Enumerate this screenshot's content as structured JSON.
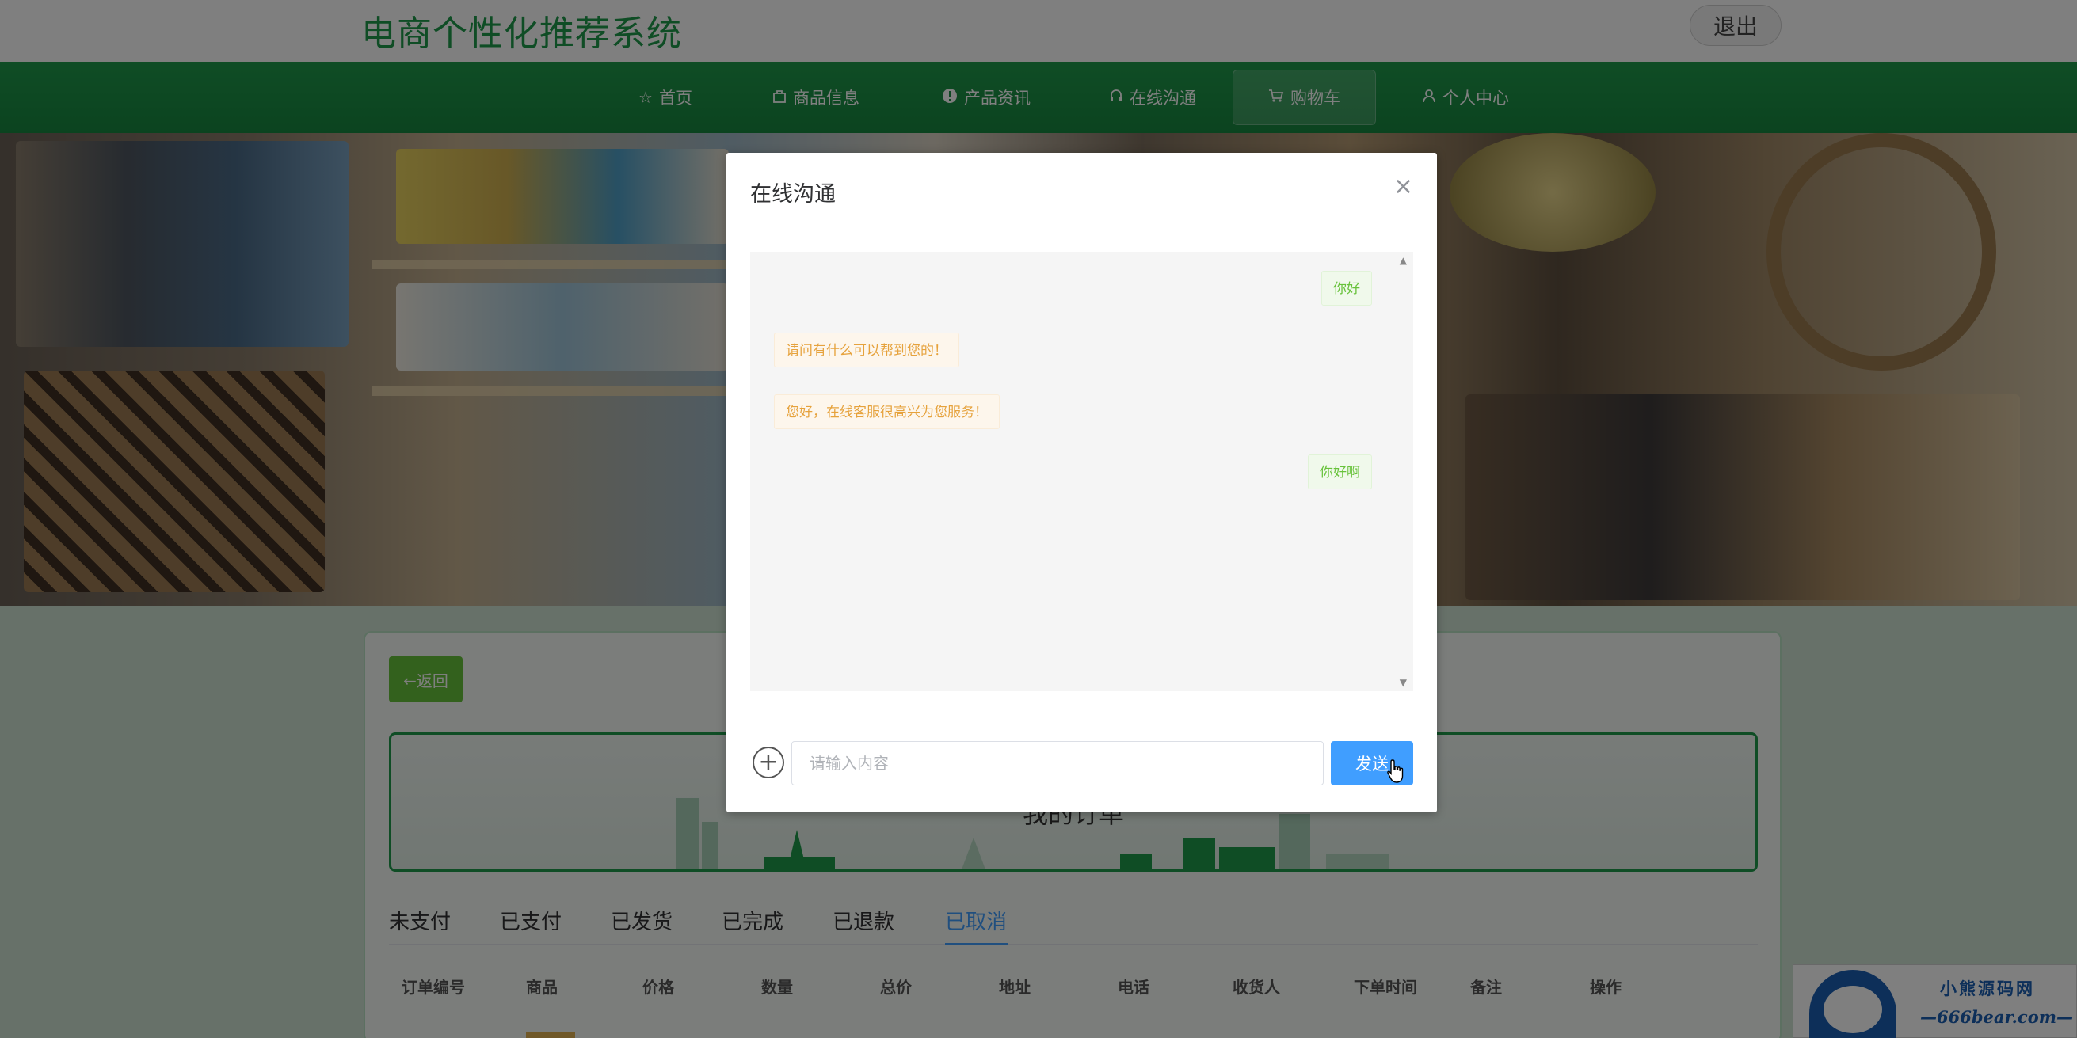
{
  "header": {
    "site_title": "电商个性化推荐系统",
    "logout_label": "退出"
  },
  "nav": {
    "items": [
      {
        "label": "首页",
        "icon": "star-icon"
      },
      {
        "label": "商品信息",
        "icon": "bag-icon"
      },
      {
        "label": "产品资讯",
        "icon": "info-icon"
      },
      {
        "label": "在线沟通",
        "icon": "headset-icon"
      },
      {
        "label": "购物车",
        "icon": "cart-icon",
        "active": true
      },
      {
        "label": "个人中心",
        "icon": "user-icon"
      }
    ]
  },
  "panel": {
    "back_label": "←返回",
    "my_orders_title": "我的订单",
    "tabs": [
      {
        "label": "未支付"
      },
      {
        "label": "已支付"
      },
      {
        "label": "已发货"
      },
      {
        "label": "已完成"
      },
      {
        "label": "已退款"
      },
      {
        "label": "已取消",
        "active": true
      }
    ],
    "columns": [
      "订单编号",
      "商品",
      "价格",
      "数量",
      "总价",
      "地址",
      "电话",
      "收货人",
      "下单时间",
      "备注",
      "操作"
    ]
  },
  "watermark": {
    "name": "小熊源码网",
    "url": "—666bear.com—"
  },
  "dialog": {
    "title": "在线沟通",
    "messages": [
      {
        "side": "right",
        "text": "你好"
      },
      {
        "side": "left",
        "text": "请问有什么可以帮到您的！"
      },
      {
        "side": "left",
        "text": "您好，在线客服很高兴为您服务！"
      },
      {
        "side": "right",
        "text": "你好啊"
      }
    ],
    "input_placeholder": "请输入内容",
    "send_label": "发送"
  },
  "colors": {
    "brand_green": "#1f9a4b",
    "primary_blue": "#409eff",
    "success_green": "#67c23a",
    "warning_orange": "#e6a23c"
  }
}
